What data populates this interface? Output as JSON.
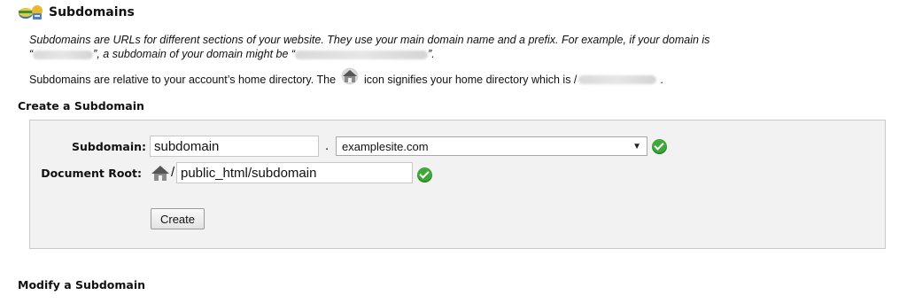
{
  "header": {
    "title": "Subdomains",
    "icon": "subdomains-globe-icon"
  },
  "intro": {
    "sentence1": "Subdomains are URLs for different sections of your website. They use your main domain name and a prefix. For example, if your domain is",
    "sentence2_part1": "“",
    "sentence2_part2": "”, a subdomain of your domain might be “",
    "sentence2_part3": "”."
  },
  "relative_note": {
    "before": "Subdomains are relative to your account’s home directory. The",
    "after": "icon signifies your home directory which is /",
    "end": "."
  },
  "create_section": {
    "title": "Create a Subdomain",
    "subdomain_label": "Subdomain:",
    "subdomain_value": "subdomain",
    "separator": ".",
    "domain_selected": "examplesite.com",
    "document_root_label": "Document Root:",
    "document_root_prefix": "/",
    "document_root_value": "public_html/subdomain",
    "create_button": "Create"
  },
  "modify_section": {
    "title": "Modify a Subdomain"
  },
  "colors": {
    "panel_bg": "#f2f2f2",
    "success_green": "#3fa83a"
  }
}
